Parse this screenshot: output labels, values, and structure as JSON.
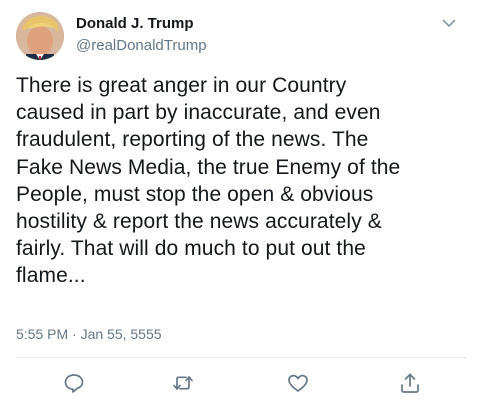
{
  "tweet": {
    "display_name": "Donald J. Trump",
    "handle": "@realDonaldTrump",
    "text": "There is great anger in our Country\ncaused in part by inaccurate, and even\nfraudulent, reporting of the news. The\nFake News Media, the true Enemy of the\nPeople, must stop the open & obvious\nhostility & report the news accurately &\nfairly. That will do much to put out the\nflame...",
    "timestamp": "5:55 PM · Jan 55, 5555"
  },
  "actions": {
    "reply_icon": "comment-icon",
    "retweet_icon": "retweet-icon",
    "like_icon": "heart-icon",
    "share_icon": "share-icon"
  },
  "colors": {
    "text": "#14171a",
    "secondary": "#657786",
    "divider": "#e6ecf0"
  }
}
